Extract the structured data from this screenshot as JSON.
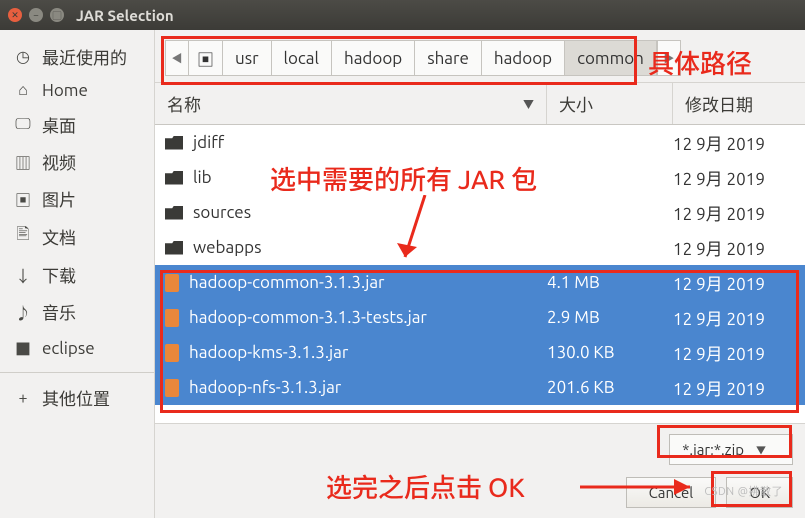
{
  "window": {
    "title": "JAR Selection"
  },
  "sidebar": {
    "items": [
      {
        "icon": "◷",
        "label": "最近使用的"
      },
      {
        "icon": "⌂",
        "label": "Home"
      },
      {
        "icon": "🖵",
        "label": "桌面"
      },
      {
        "icon": "▥",
        "label": "视频"
      },
      {
        "icon": "▣",
        "label": "图片"
      },
      {
        "icon": "🖹",
        "label": "文档"
      },
      {
        "icon": "↓",
        "label": "下载"
      },
      {
        "icon": "♪",
        "label": "音乐"
      },
      {
        "icon": "■",
        "label": "eclipse"
      }
    ],
    "other_label": "其他位置",
    "other_icon": "+"
  },
  "breadcrumb": {
    "items": [
      "usr",
      "local",
      "hadoop",
      "share",
      "hadoop",
      "common"
    ],
    "root_icon": "▣"
  },
  "columns": {
    "name": "名称",
    "size": "大小",
    "date": "修改日期"
  },
  "files": [
    {
      "name": "jdiff",
      "type": "folder",
      "size": "",
      "date": "12 9月 2019",
      "selected": false
    },
    {
      "name": "lib",
      "type": "folder",
      "size": "",
      "date": "12 9月 2019",
      "selected": false
    },
    {
      "name": "sources",
      "type": "folder",
      "size": "",
      "date": "12 9月 2019",
      "selected": false
    },
    {
      "name": "webapps",
      "type": "folder",
      "size": "",
      "date": "12 9月 2019",
      "selected": false
    },
    {
      "name": "hadoop-common-3.1.3.jar",
      "type": "jar",
      "size": "4.1 MB",
      "date": "12 9月 2019",
      "selected": true
    },
    {
      "name": "hadoop-common-3.1.3-tests.jar",
      "type": "jar",
      "size": "2.9 MB",
      "date": "12 9月 2019",
      "selected": true
    },
    {
      "name": "hadoop-kms-3.1.3.jar",
      "type": "jar",
      "size": "130.0 KB",
      "date": "12 9月 2019",
      "selected": true
    },
    {
      "name": "hadoop-nfs-3.1.3.jar",
      "type": "jar",
      "size": "201.6 KB",
      "date": "12 9月 2019",
      "selected": true
    }
  ],
  "filter": {
    "label": "*.jar;*.zip"
  },
  "buttons": {
    "cancel": "Cancel",
    "ok": "OK"
  },
  "annotations": {
    "path_label": "具体路径",
    "select_label": "选中需要的所有 JAR 包",
    "ok_label": "选完之后点击 OK"
  },
  "watermark": "CSDN @拂散了"
}
